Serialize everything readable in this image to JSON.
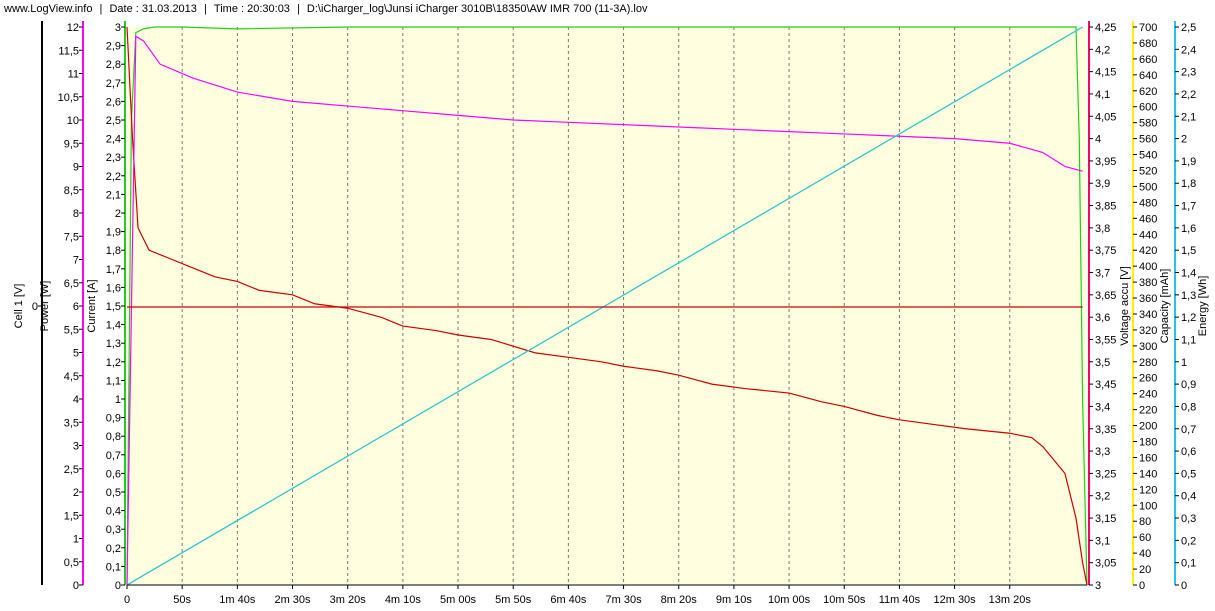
{
  "header": {
    "site": "www.LogView.info",
    "separator": "|",
    "date": "Date : 31.03.2013",
    "time": "Time : 20:30:03",
    "file": "D:\\iCharger_log\\Junsi iCharger 3010B\\18350\\AW IMR 700 (11-3A).lov"
  },
  "colors": {
    "plot_bg": "#ffffe0",
    "cell1": "#000000",
    "power": "#ff00ff",
    "current": "#22cc22",
    "voltage": "#cc0000",
    "capacity": "#ffee00",
    "energy": "#22c4e8",
    "voltage_axis_line": "#ff0066"
  },
  "chart_data": {
    "type": "line",
    "x_ticks": [
      "0",
      "50s",
      "1m 40s",
      "2m 30s",
      "3m 20s",
      "4m 10s",
      "5m 00s",
      "5m 50s",
      "6m 40s",
      "7m 30s",
      "8m 20s",
      "9m 10s",
      "10m 00s",
      "10m 50s",
      "11m 40s",
      "12m 30s",
      "13m 20s"
    ],
    "xlim": [
      0,
      870
    ],
    "grid": true,
    "axes": {
      "cell1": {
        "label": "Cell 1 [V]",
        "ticks": [
          "0"
        ]
      },
      "power": {
        "label": "Power [W]",
        "ticks": [
          "0",
          "0,5",
          "1",
          "1,5",
          "2",
          "2,5",
          "3",
          "3,5",
          "4",
          "4,5",
          "5",
          "5,5",
          "6",
          "6,5",
          "7",
          "7,5",
          "8",
          "8,5",
          "9",
          "9,5",
          "10",
          "10,5",
          "11",
          "11,5",
          "12"
        ],
        "range": [
          0,
          12
        ]
      },
      "current": {
        "label": "Current [A]",
        "ticks": [
          "0",
          "0,1",
          "0,2",
          "0,3",
          "0,4",
          "0,5",
          "0,6",
          "0,7",
          "0,8",
          "0,9",
          "1",
          "1,1",
          "1,2",
          "1,3",
          "1,4",
          "1,5",
          "1,6",
          "1,7",
          "1,8",
          "1,9",
          "2",
          "2,1",
          "2,2",
          "2,3",
          "2,4",
          "2,5",
          "2,6",
          "2,7",
          "2,8",
          "2,9",
          "3"
        ],
        "range": [
          0,
          3
        ]
      },
      "voltage": {
        "label": "Voltage accu [V]",
        "ticks": [
          "3",
          "3,05",
          "3,1",
          "3,15",
          "3,2",
          "3,25",
          "3,3",
          "3,35",
          "3,4",
          "3,45",
          "3,5",
          "3,55",
          "3,6",
          "3,65",
          "3,7",
          "3,75",
          "3,8",
          "3,85",
          "3,9",
          "3,95",
          "4",
          "4,05",
          "4,1",
          "4,15",
          "4,2",
          "4,25"
        ],
        "range": [
          3,
          4.25
        ]
      },
      "capacity": {
        "label": "Capacity [mAh]",
        "ticks": [
          "0",
          "20",
          "40",
          "60",
          "80",
          "100",
          "120",
          "140",
          "160",
          "180",
          "200",
          "220",
          "240",
          "260",
          "280",
          "300",
          "320",
          "340",
          "360",
          "380",
          "400",
          "420",
          "440",
          "460",
          "480",
          "500",
          "520",
          "540",
          "560",
          "580",
          "600",
          "620",
          "640",
          "660",
          "680",
          "700"
        ],
        "range": [
          0,
          700
        ]
      },
      "energy": {
        "label": "Energy [Wh]",
        "ticks": [
          "0",
          "0,1",
          "0,2",
          "0,3",
          "0,4",
          "0,5",
          "0,6",
          "0,7",
          "0,8",
          "0,9",
          "1",
          "1,1",
          "1,2",
          "1,3",
          "1,4",
          "1,5",
          "1,6",
          "1,7",
          "1,8",
          "1,9",
          "2",
          "2,1",
          "2,2",
          "2,3",
          "2,4",
          "2,5"
        ],
        "range": [
          0,
          2.5
        ]
      }
    },
    "series": [
      {
        "axis": "current",
        "x": [
          0,
          4,
          8,
          15,
          25,
          50,
          100,
          200,
          300,
          400,
          500,
          600,
          700,
          800,
          860,
          863,
          866,
          870
        ],
        "y": [
          0,
          2.5,
          2.97,
          2.99,
          3.0,
          3.0,
          2.99,
          3.0,
          3.0,
          3.0,
          3.0,
          3.0,
          3.0,
          3.0,
          3.0,
          2.4,
          1.0,
          0
        ]
      },
      {
        "axis": "voltage",
        "x": [
          0,
          5,
          10,
          20,
          40,
          60,
          80,
          100,
          120,
          150,
          170,
          200,
          230,
          250,
          280,
          300,
          330,
          370,
          400,
          430,
          450,
          480,
          500,
          530,
          560,
          600,
          630,
          650,
          680,
          700,
          730,
          760,
          800,
          820,
          830,
          840,
          850,
          860,
          866,
          870
        ],
        "y": [
          4.25,
          4.0,
          3.8,
          3.75,
          3.73,
          3.71,
          3.69,
          3.68,
          3.66,
          3.65,
          3.63,
          3.62,
          3.6,
          3.58,
          3.57,
          3.56,
          3.55,
          3.52,
          3.51,
          3.5,
          3.49,
          3.48,
          3.47,
          3.45,
          3.44,
          3.43,
          3.41,
          3.4,
          3.38,
          3.37,
          3.36,
          3.35,
          3.34,
          3.33,
          3.31,
          3.28,
          3.25,
          3.15,
          3.05,
          3.0
        ]
      },
      {
        "axis": "power",
        "x": [
          0,
          8,
          15,
          30,
          60,
          100,
          150,
          200,
          250,
          300,
          350,
          400,
          450,
          500,
          550,
          600,
          650,
          700,
          750,
          800,
          830,
          850,
          866
        ],
        "y": [
          0,
          11.8,
          11.7,
          11.2,
          10.9,
          10.6,
          10.4,
          10.3,
          10.2,
          10.1,
          10.0,
          9.95,
          9.9,
          9.85,
          9.8,
          9.75,
          9.7,
          9.65,
          9.6,
          9.5,
          9.3,
          9.0,
          8.9
        ]
      },
      {
        "axis": "capacity",
        "x": [
          0,
          866
        ],
        "y": [
          0,
          700
        ]
      },
      {
        "axis": "energy",
        "x": [
          0,
          866
        ],
        "y": [
          0,
          2.5
        ]
      },
      {
        "axis": "cell1",
        "x": [
          0,
          866
        ],
        "y": [
          0,
          0
        ]
      }
    ]
  }
}
